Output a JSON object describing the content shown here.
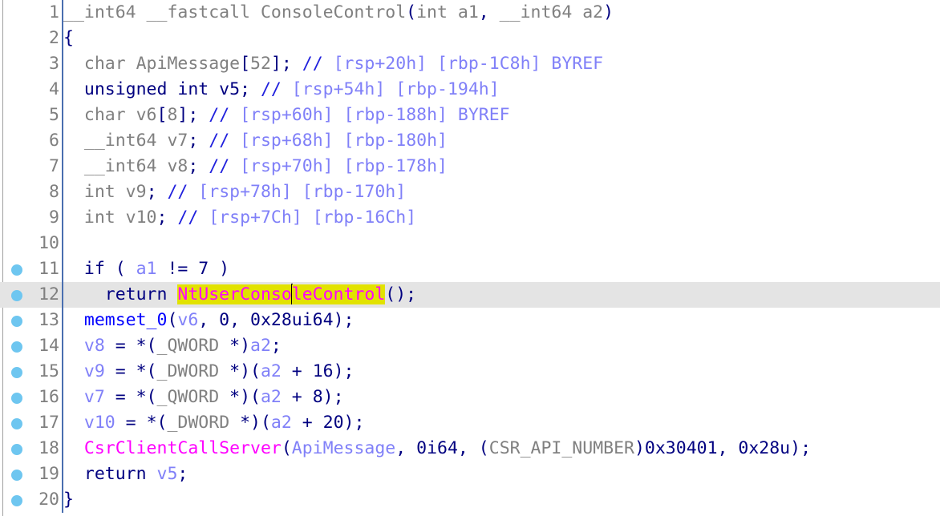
{
  "view": {
    "name": "ida-pseudocode-view",
    "background": "#ffffff",
    "current_line_highlight": "#e4e4e4",
    "highlighted_identifier": "NtUserConsoleControl",
    "highlight_color": "#e2e200",
    "caret_line": 12,
    "caret_after_text": "NtUserConso"
  },
  "colors": {
    "keyword": "#000080",
    "punctuation": "#000080",
    "number": "#000080",
    "type": "#808080",
    "plain": "#808080",
    "variable": "#8080f8",
    "comment": "#8080f8",
    "comment_slashes": "#2020dd",
    "function": "#0000ff",
    "import": "#ff00ff",
    "line_number": "#7f7f7f",
    "breakpoint_dot": "#6ec6f0",
    "gutter_separator": "#4a6fb0"
  },
  "lines": [
    {
      "n": "1",
      "breakpoint": false,
      "current": false,
      "text": "__int64 __fastcall ConsoleControl(int a1, __int64 a2)",
      "tokens": [
        {
          "t": "__int64 __fastcall ConsoleControl",
          "c": "t-plain"
        },
        {
          "t": "(",
          "c": "t-punct"
        },
        {
          "t": "int a1",
          "c": "t-plain"
        },
        {
          "t": ",",
          "c": "t-punct"
        },
        {
          "t": " __int64 a2",
          "c": "t-plain"
        },
        {
          "t": ")",
          "c": "t-punct"
        }
      ]
    },
    {
      "n": "2",
      "breakpoint": false,
      "current": false,
      "text": "{",
      "tokens": [
        {
          "t": "{",
          "c": "t-punct"
        }
      ]
    },
    {
      "n": "3",
      "breakpoint": false,
      "current": false,
      "text": "  char ApiMessage[52]; // [rsp+20h] [rbp-1C8h] BYREF",
      "tokens": [
        {
          "t": "  char ApiMessage",
          "c": "t-plain"
        },
        {
          "t": "[",
          "c": "t-punct"
        },
        {
          "t": "52",
          "c": "t-plain"
        },
        {
          "t": "];",
          "c": "t-punct"
        },
        {
          "t": " ",
          "c": "t-plain"
        },
        {
          "t": "//",
          "c": "t-slash"
        },
        {
          "t": " [rsp+20h] [rbp-1C8h] BYREF",
          "c": "t-comment"
        }
      ]
    },
    {
      "n": "4",
      "breakpoint": false,
      "current": false,
      "text": "  unsigned int v5; // [rsp+54h] [rbp-194h]",
      "tokens": [
        {
          "t": "  unsigned int v5;",
          "c": "t-kw"
        },
        {
          "t": " ",
          "c": "t-plain"
        },
        {
          "t": "//",
          "c": "t-slash"
        },
        {
          "t": " [rsp+54h] [rbp-194h]",
          "c": "t-comment"
        }
      ]
    },
    {
      "n": "5",
      "breakpoint": false,
      "current": false,
      "text": "  char v6[8]; // [rsp+60h] [rbp-188h] BYREF",
      "tokens": [
        {
          "t": "  char v6",
          "c": "t-plain"
        },
        {
          "t": "[",
          "c": "t-punct"
        },
        {
          "t": "8",
          "c": "t-plain"
        },
        {
          "t": "];",
          "c": "t-punct"
        },
        {
          "t": " ",
          "c": "t-plain"
        },
        {
          "t": "//",
          "c": "t-slash"
        },
        {
          "t": " [rsp+60h] [rbp-188h] BYREF",
          "c": "t-comment"
        }
      ]
    },
    {
      "n": "6",
      "breakpoint": false,
      "current": false,
      "text": "  __int64 v7; // [rsp+68h] [rbp-180h]",
      "tokens": [
        {
          "t": "  __int64 v7",
          "c": "t-plain"
        },
        {
          "t": ";",
          "c": "t-punct"
        },
        {
          "t": " ",
          "c": "t-plain"
        },
        {
          "t": "//",
          "c": "t-slash"
        },
        {
          "t": " [rsp+68h] [rbp-180h]",
          "c": "t-comment"
        }
      ]
    },
    {
      "n": "7",
      "breakpoint": false,
      "current": false,
      "text": "  __int64 v8; // [rsp+70h] [rbp-178h]",
      "tokens": [
        {
          "t": "  __int64 v8",
          "c": "t-plain"
        },
        {
          "t": ";",
          "c": "t-punct"
        },
        {
          "t": " ",
          "c": "t-plain"
        },
        {
          "t": "//",
          "c": "t-slash"
        },
        {
          "t": " [rsp+70h] [rbp-178h]",
          "c": "t-comment"
        }
      ]
    },
    {
      "n": "8",
      "breakpoint": false,
      "current": false,
      "text": "  int v9; // [rsp+78h] [rbp-170h]",
      "tokens": [
        {
          "t": "  int v9",
          "c": "t-plain"
        },
        {
          "t": ";",
          "c": "t-punct"
        },
        {
          "t": " ",
          "c": "t-plain"
        },
        {
          "t": "//",
          "c": "t-slash"
        },
        {
          "t": " [rsp+78h] [rbp-170h]",
          "c": "t-comment"
        }
      ]
    },
    {
      "n": "9",
      "breakpoint": false,
      "current": false,
      "text": "  int v10; // [rsp+7Ch] [rbp-16Ch]",
      "tokens": [
        {
          "t": "  int v10",
          "c": "t-plain"
        },
        {
          "t": ";",
          "c": "t-punct"
        },
        {
          "t": " ",
          "c": "t-plain"
        },
        {
          "t": "//",
          "c": "t-slash"
        },
        {
          "t": " [rsp+7Ch] [rbp-16Ch]",
          "c": "t-comment"
        }
      ]
    },
    {
      "n": "10",
      "breakpoint": false,
      "current": false,
      "text": "",
      "tokens": []
    },
    {
      "n": "11",
      "breakpoint": true,
      "current": false,
      "text": "  if ( a1 != 7 )",
      "tokens": [
        {
          "t": "  if ( ",
          "c": "t-kw"
        },
        {
          "t": "a1",
          "c": "t-var"
        },
        {
          "t": " != 7 )",
          "c": "t-punct"
        }
      ]
    },
    {
      "n": "12",
      "breakpoint": true,
      "current": true,
      "text": "    return NtUserConsoleControl();",
      "tokens": [
        {
          "t": "    return ",
          "c": "t-kw"
        },
        {
          "t": "NtUserConso",
          "c": "t-import",
          "hl": true
        },
        {
          "t": "",
          "c": "caret"
        },
        {
          "t": "leControl",
          "c": "t-import",
          "hl": true
        },
        {
          "t": "();",
          "c": "t-punct"
        }
      ]
    },
    {
      "n": "13",
      "breakpoint": true,
      "current": false,
      "text": "  memset_0(v6, 0, 0x28ui64);",
      "tokens": [
        {
          "t": "  ",
          "c": "t-plain"
        },
        {
          "t": "memset_0",
          "c": "t-func"
        },
        {
          "t": "(",
          "c": "t-punct"
        },
        {
          "t": "v6",
          "c": "t-var"
        },
        {
          "t": ", 0, 0x28ui64);",
          "c": "t-punct"
        }
      ]
    },
    {
      "n": "14",
      "breakpoint": true,
      "current": false,
      "text": "  v8 = *(_QWORD *)a2;",
      "tokens": [
        {
          "t": "  ",
          "c": "t-plain"
        },
        {
          "t": "v8",
          "c": "t-var"
        },
        {
          "t": " = *(",
          "c": "t-punct"
        },
        {
          "t": "_QWORD",
          "c": "t-type"
        },
        {
          "t": " *)",
          "c": "t-punct"
        },
        {
          "t": "a2",
          "c": "t-var"
        },
        {
          "t": ";",
          "c": "t-punct"
        }
      ]
    },
    {
      "n": "15",
      "breakpoint": true,
      "current": false,
      "text": "  v9 = *(_DWORD *)(a2 + 16);",
      "tokens": [
        {
          "t": "  ",
          "c": "t-plain"
        },
        {
          "t": "v9",
          "c": "t-var"
        },
        {
          "t": " = *(",
          "c": "t-punct"
        },
        {
          "t": "_DWORD",
          "c": "t-type"
        },
        {
          "t": " *)(",
          "c": "t-punct"
        },
        {
          "t": "a2",
          "c": "t-var"
        },
        {
          "t": " + 16);",
          "c": "t-punct"
        }
      ]
    },
    {
      "n": "16",
      "breakpoint": true,
      "current": false,
      "text": "  v7 = *(_QWORD *)(a2 + 8);",
      "tokens": [
        {
          "t": "  ",
          "c": "t-plain"
        },
        {
          "t": "v7",
          "c": "t-var"
        },
        {
          "t": " = *(",
          "c": "t-punct"
        },
        {
          "t": "_QWORD",
          "c": "t-type"
        },
        {
          "t": " *)(",
          "c": "t-punct"
        },
        {
          "t": "a2",
          "c": "t-var"
        },
        {
          "t": " + 8);",
          "c": "t-punct"
        }
      ]
    },
    {
      "n": "17",
      "breakpoint": true,
      "current": false,
      "text": "  v10 = *(_DWORD *)(a2 + 20);",
      "tokens": [
        {
          "t": "  ",
          "c": "t-plain"
        },
        {
          "t": "v10",
          "c": "t-var"
        },
        {
          "t": " = *(",
          "c": "t-punct"
        },
        {
          "t": "_DWORD",
          "c": "t-type"
        },
        {
          "t": " *)(",
          "c": "t-punct"
        },
        {
          "t": "a2",
          "c": "t-var"
        },
        {
          "t": " + 20);",
          "c": "t-punct"
        }
      ]
    },
    {
      "n": "18",
      "breakpoint": true,
      "current": false,
      "text": "  CsrClientCallServer(ApiMessage, 0i64, (CSR_API_NUMBER)0x30401, 0x28u);",
      "tokens": [
        {
          "t": "  ",
          "c": "t-plain"
        },
        {
          "t": "CsrClientCallServer",
          "c": "t-import"
        },
        {
          "t": "(",
          "c": "t-punct"
        },
        {
          "t": "ApiMessage",
          "c": "t-var"
        },
        {
          "t": ", 0i64, (",
          "c": "t-punct"
        },
        {
          "t": "CSR_API_NUMBER",
          "c": "t-type"
        },
        {
          "t": ")0x30401, 0x28u);",
          "c": "t-punct"
        }
      ]
    },
    {
      "n": "19",
      "breakpoint": true,
      "current": false,
      "text": "  return v5;",
      "tokens": [
        {
          "t": "  return ",
          "c": "t-kw"
        },
        {
          "t": "v5",
          "c": "t-var"
        },
        {
          "t": ";",
          "c": "t-punct"
        }
      ]
    },
    {
      "n": "20",
      "breakpoint": true,
      "current": false,
      "text": "}",
      "tokens": [
        {
          "t": "}",
          "c": "t-punct"
        }
      ]
    }
  ]
}
